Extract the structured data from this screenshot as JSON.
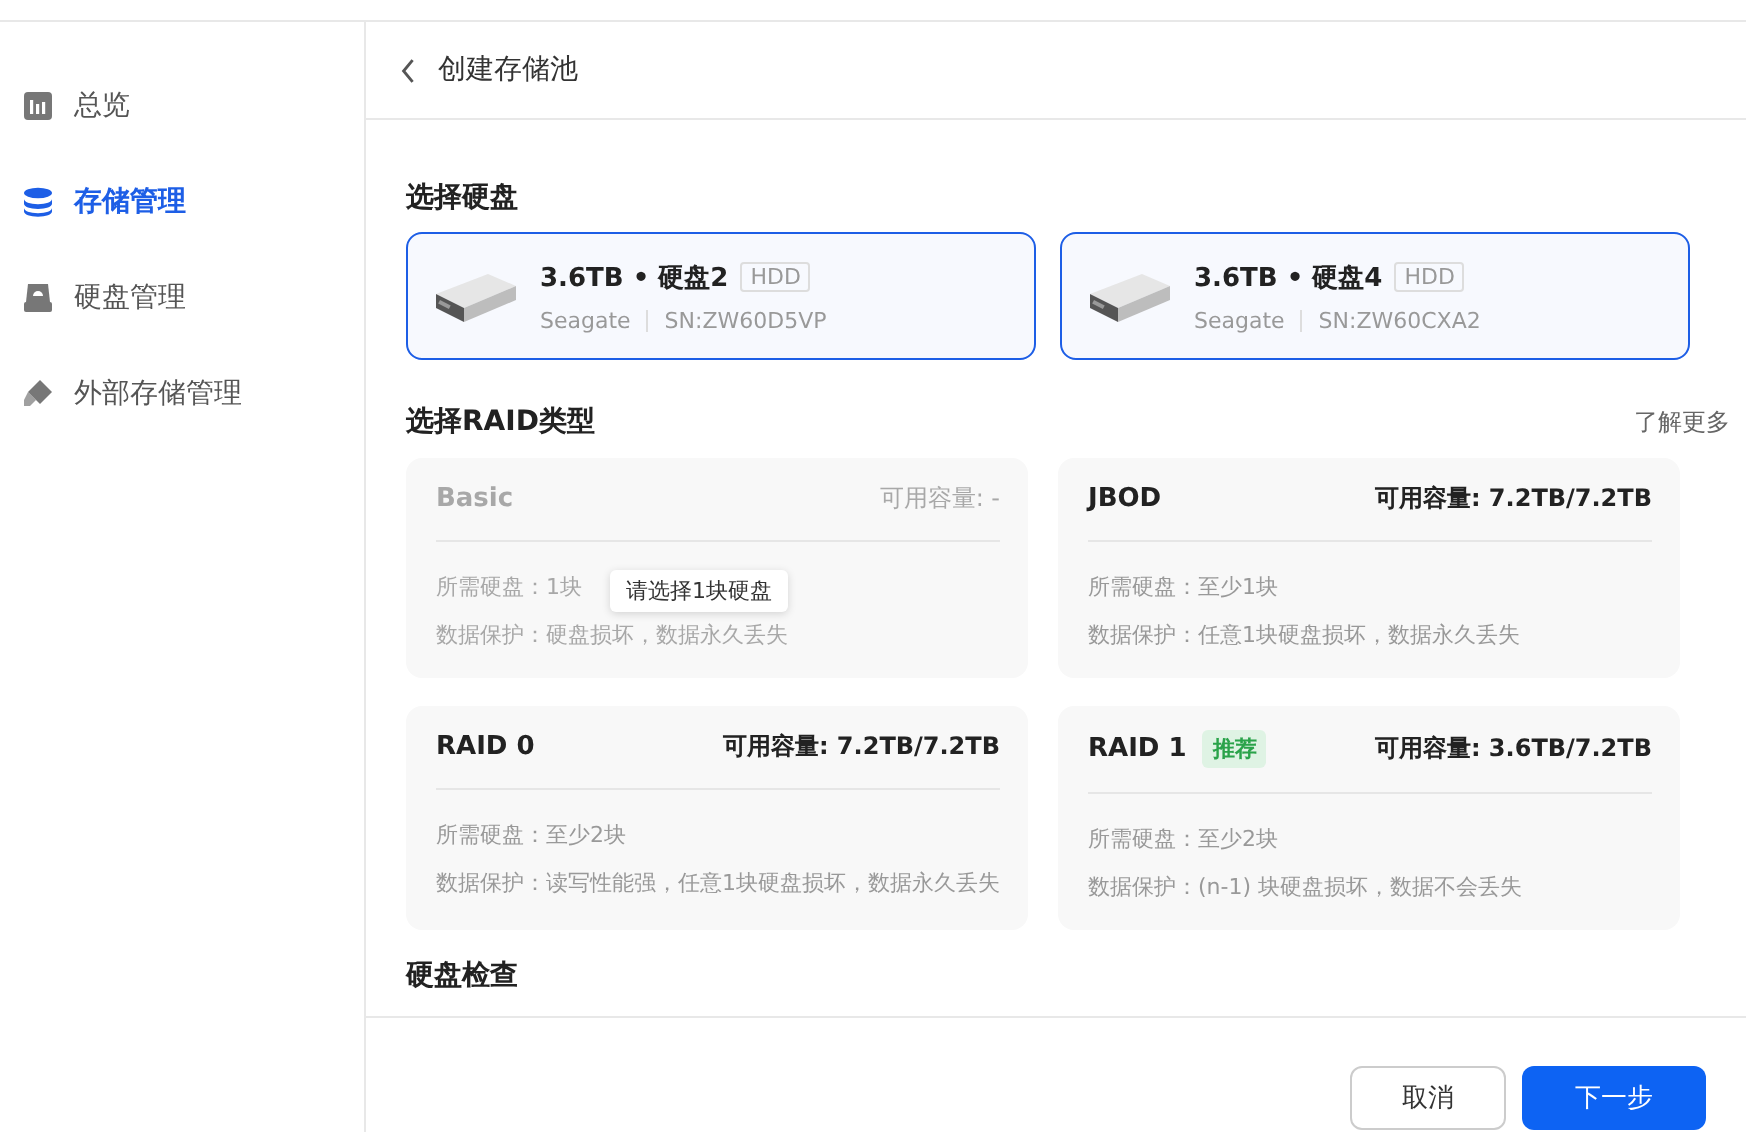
{
  "sidebar": {
    "items": [
      {
        "label": "总览",
        "selected": false
      },
      {
        "label": "存储管理",
        "selected": true
      },
      {
        "label": "硬盘管理",
        "selected": false
      },
      {
        "label": "外部存储管理",
        "selected": false
      }
    ]
  },
  "header": {
    "title": "创建存储池"
  },
  "disk_section": {
    "title": "选择硬盘",
    "disks": [
      {
        "title": "3.6TB • 硬盘2",
        "type": "HDD",
        "vendor": "Seagate",
        "serial": "SN:ZW60D5VP",
        "selected": true
      },
      {
        "title": "3.6TB • 硬盘4",
        "type": "HDD",
        "vendor": "Seagate",
        "serial": "SN:ZW60CXA2",
        "selected": true
      }
    ]
  },
  "raid_section": {
    "title": "选择RAID类型",
    "learn_more": "了解更多",
    "options": [
      {
        "name": "Basic",
        "capacity": "可用容量: -",
        "required": "所需硬盘：1块",
        "protection": "数据保护：硬盘损坏，数据永久丢失",
        "disabled": true,
        "tooltip": "请选择1块硬盘"
      },
      {
        "name": "JBOD",
        "capacity": "可用容量: 7.2TB/7.2TB",
        "required": "所需硬盘：至少1块",
        "protection": "数据保护：任意1块硬盘损坏，数据永久丢失",
        "disabled": false
      },
      {
        "name": "RAID 0",
        "capacity": "可用容量: 7.2TB/7.2TB",
        "required": "所需硬盘：至少2块",
        "protection": "数据保护：读写性能强，任意1块硬盘损坏，数据永久丢失",
        "disabled": false
      },
      {
        "name": "RAID 1",
        "badge": "推荐",
        "capacity": "可用容量: 3.6TB/7.2TB",
        "required": "所需硬盘：至少2块",
        "protection": "数据保护：(n-1) 块硬盘损坏，数据不会丢失",
        "disabled": false
      }
    ]
  },
  "check_section": {
    "title": "硬盘检查"
  },
  "footer": {
    "buttons": [
      {
        "label": "取消",
        "kind": "secondary"
      },
      {
        "label": "下一步",
        "kind": "primary"
      }
    ]
  }
}
